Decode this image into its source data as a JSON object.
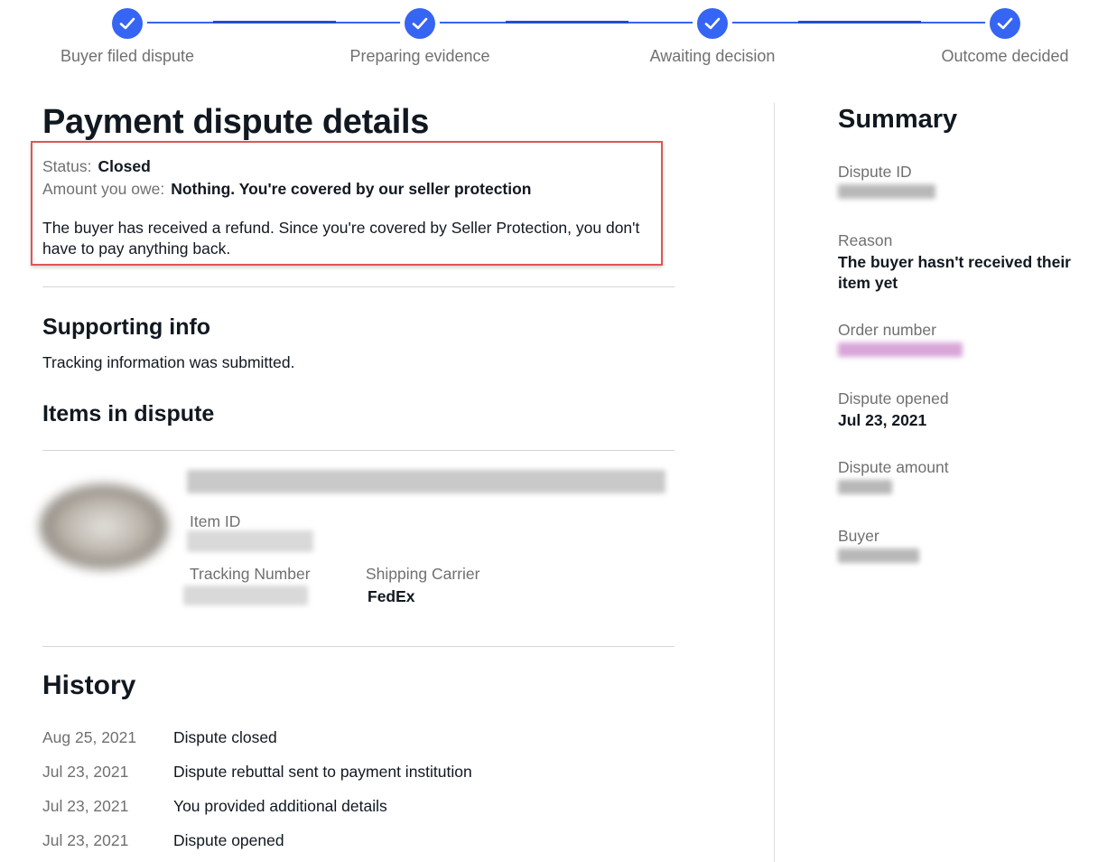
{
  "stepper": {
    "steps": [
      {
        "label": "Buyer filed dispute",
        "done": true
      },
      {
        "label": "Preparing evidence",
        "done": true
      },
      {
        "label": "Awaiting decision",
        "done": true
      },
      {
        "label": "Outcome decided",
        "done": true
      }
    ],
    "accent_color": "#3665f3"
  },
  "page": {
    "title": "Payment dispute details",
    "status_label": "Status:",
    "status_value": "Closed",
    "amount_label": "Amount you owe:",
    "amount_value": "Nothing. You're covered by our seller protection",
    "message": "The buyer has received a refund. Since you're covered by Seller Protection, you don't have to pay anything back."
  },
  "supporting_info": {
    "title": "Supporting info",
    "text": "Tracking information was submitted."
  },
  "items": {
    "title": "Items in dispute",
    "item_id_label": "Item ID",
    "tracking_label": "Tracking Number",
    "carrier_label": "Shipping Carrier",
    "carrier_value": "FedEx"
  },
  "history": {
    "title": "History",
    "entries": [
      {
        "date": "Aug 25, 2021",
        "text": "Dispute closed"
      },
      {
        "date": "Jul 23, 2021",
        "text": "Dispute rebuttal sent to payment institution"
      },
      {
        "date": "Jul 23, 2021",
        "text": "You provided additional details"
      },
      {
        "date": "Jul 23, 2021",
        "text": "Dispute opened"
      }
    ]
  },
  "summary": {
    "title": "Summary",
    "dispute_id_label": "Dispute ID",
    "reason_label": "Reason",
    "reason_value": "The buyer hasn't received their item yet",
    "order_number_label": "Order number",
    "opened_label": "Dispute opened",
    "opened_value": "Jul 23, 2021",
    "amount_label": "Dispute amount",
    "buyer_label": "Buyer"
  }
}
